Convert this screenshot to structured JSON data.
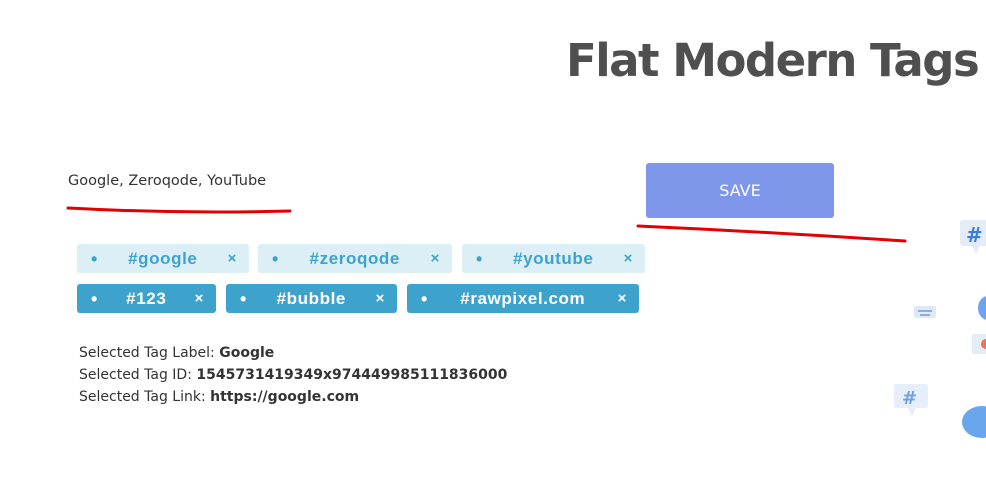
{
  "page": {
    "title": "Flat Modern Tags"
  },
  "input": {
    "value": "Google, Zeroqode, YouTube"
  },
  "save_button": {
    "label": "SAVE"
  },
  "tags": {
    "dot": "•",
    "remove": "×",
    "row1": [
      {
        "label": "#google"
      },
      {
        "label": "#zeroqode"
      },
      {
        "label": "#youtube"
      }
    ],
    "row2": [
      {
        "label": "#123"
      },
      {
        "label": "#bubble"
      },
      {
        "label": "#rawpixel.com"
      }
    ]
  },
  "selected": {
    "label_caption": "Selected Tag Label:",
    "label_value": "Google",
    "id_caption": "Selected Tag ID:",
    "id_value": "1545731419349x974449985111836000",
    "link_caption": "Selected Tag Link:",
    "link_value": "https://google.com"
  },
  "colors": {
    "accent": "#7f97eb",
    "tag_light_bg": "#dceef6",
    "tag_dark_bg": "#3ea3cc",
    "mark_red": "#e30000"
  },
  "decor_icons": [
    "hash-bubble-icon",
    "chat-bubble-icon",
    "heart-bubble-icon"
  ]
}
